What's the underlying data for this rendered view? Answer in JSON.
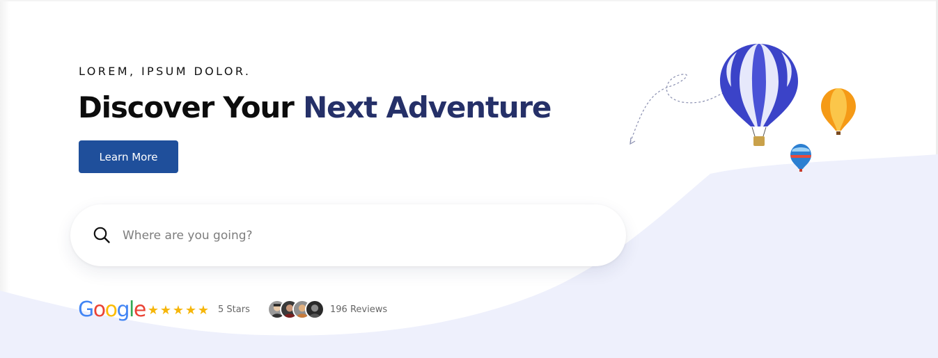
{
  "hero": {
    "eyebrow": "LOREM, IPSUM DOLOR.",
    "headline_part1": "Discover Your",
    "headline_part2": "Next Adventure",
    "cta_label": "Learn More"
  },
  "search": {
    "placeholder": "Where are you going?",
    "icon": "search-icon"
  },
  "rating": {
    "provider_letters": [
      "G",
      "o",
      "o",
      "g",
      "l",
      "e"
    ],
    "stars_count": 5,
    "stars_label": "5 Stars",
    "reviews_label": "196 Reviews",
    "reviewer_avatar_count": 4
  },
  "colors": {
    "accent_navy": "#253068",
    "button_blue": "#1f4f9b",
    "star_gold": "#f6b60a",
    "wave_bg": "#eef0fc"
  },
  "decor": {
    "illustration": "hot-air-balloons"
  }
}
